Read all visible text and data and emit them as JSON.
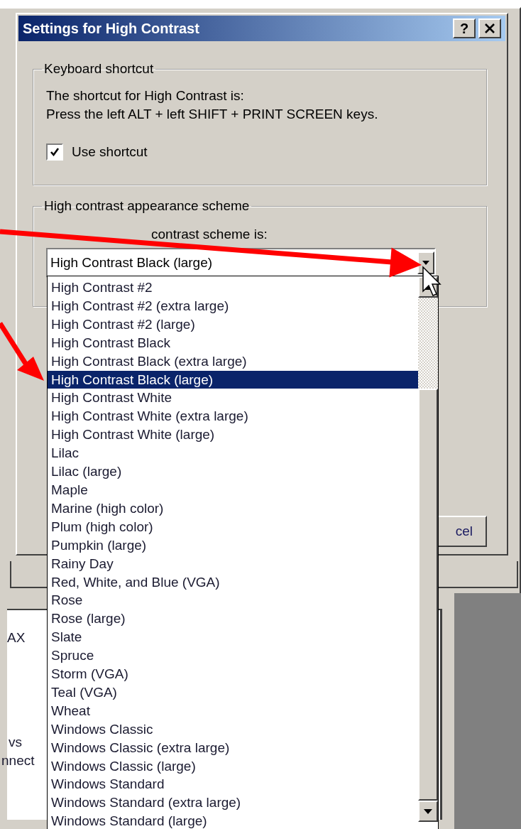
{
  "background_window": {
    "texts": [
      "AX",
      "vs",
      "nnect"
    ]
  },
  "dialog": {
    "title": "Settings for High Contrast",
    "help_button": "?",
    "keyboard_group": {
      "legend": "Keyboard shortcut",
      "lines": [
        "The shortcut for High Contrast is:",
        "Press the left ALT + left SHIFT + PRINT SCREEN keys."
      ],
      "checkbox": {
        "label": "Use shortcut",
        "checked": true
      }
    },
    "scheme_group": {
      "legend": "High contrast appearance scheme",
      "label": "contrast scheme is:",
      "combo_value": "High Contrast Black (large)"
    },
    "cancel_button": "cel"
  },
  "dropdown": {
    "items": [
      {
        "label": "High Contrast #2",
        "selected": false
      },
      {
        "label": "High Contrast #2 (extra large)",
        "selected": false
      },
      {
        "label": "High Contrast #2 (large)",
        "selected": false
      },
      {
        "label": "High Contrast Black",
        "selected": false
      },
      {
        "label": "High Contrast Black (extra large)",
        "selected": false
      },
      {
        "label": "High Contrast Black (large)",
        "selected": true
      },
      {
        "label": "High Contrast White",
        "selected": false
      },
      {
        "label": "High Contrast White (extra large)",
        "selected": false
      },
      {
        "label": "High Contrast White (large)",
        "selected": false
      },
      {
        "label": "Lilac",
        "selected": false
      },
      {
        "label": "Lilac (large)",
        "selected": false
      },
      {
        "label": "Maple",
        "selected": false
      },
      {
        "label": "Marine (high color)",
        "selected": false
      },
      {
        "label": "Plum (high color)",
        "selected": false
      },
      {
        "label": "Pumpkin (large)",
        "selected": false
      },
      {
        "label": "Rainy Day",
        "selected": false
      },
      {
        "label": "Red, White, and Blue (VGA)",
        "selected": false
      },
      {
        "label": "Rose",
        "selected": false
      },
      {
        "label": "Rose (large)",
        "selected": false
      },
      {
        "label": "Slate",
        "selected": false
      },
      {
        "label": "Spruce",
        "selected": false
      },
      {
        "label": "Storm (VGA)",
        "selected": false
      },
      {
        "label": "Teal (VGA)",
        "selected": false
      },
      {
        "label": "Wheat",
        "selected": false
      },
      {
        "label": "Windows Classic",
        "selected": false
      },
      {
        "label": "Windows Classic (extra large)",
        "selected": false
      },
      {
        "label": "Windows Classic (large)",
        "selected": false
      },
      {
        "label": "Windows Standard",
        "selected": false
      },
      {
        "label": "Windows Standard (extra large)",
        "selected": false
      },
      {
        "label": "Windows Standard (large)",
        "selected": false
      }
    ]
  }
}
